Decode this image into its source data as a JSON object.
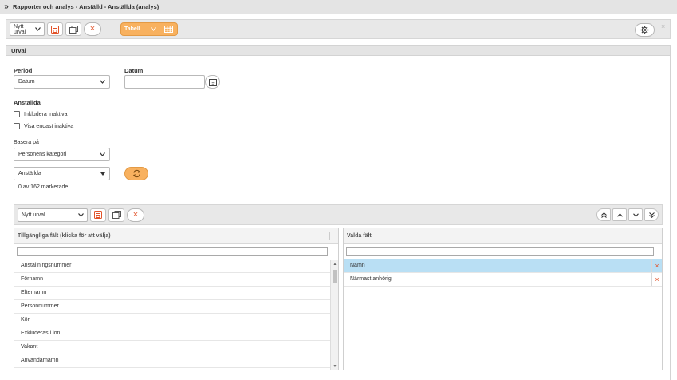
{
  "titlebar": {
    "title": "Rapporter och analys - Anställd - Anställda (analys)"
  },
  "toolbar": {
    "selection_value": "Nytt urval",
    "view_label": "Tabell"
  },
  "panel": {
    "title": "Urval",
    "period_label": "Period",
    "period_value": "Datum",
    "date_label": "Datum",
    "date_value": "",
    "employees_label": "Anställda",
    "include_inactive": "Inkludera inaktiva",
    "show_only_inactive": "Visa endast inaktiva",
    "based_on_label": "Basera på",
    "based_on_value": "Personens kategori",
    "category_value": "Anställda",
    "marked_count": "0 av 162 markerade"
  },
  "fields_toolbar": {
    "selection_value": "Nytt urval"
  },
  "available_fields": {
    "header": "Tillgängliga fält (klicka för att välja)",
    "filter_value": "",
    "items": [
      "Anställningsnummer",
      "Förnamn",
      "Efternamn",
      "Personnummer",
      "Kön",
      "Exkluderas i lön",
      "Vakant",
      "Användarnamn"
    ]
  },
  "selected_fields": {
    "header": "Valda fält",
    "filter_value": "",
    "items": [
      "Namn",
      "Närmast anhörig"
    ]
  },
  "colors": {
    "accent": "#f8b15f",
    "selected_row": "#b9dff4",
    "remove": "#e2532a"
  }
}
